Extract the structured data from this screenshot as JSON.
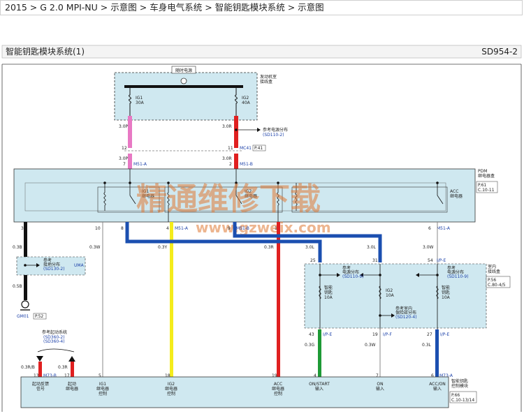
{
  "breadcrumb": {
    "items": [
      "2015",
      "G 2.0 MPI-NU",
      "示意图",
      "车身电气系统",
      "智能钥匙模块系统",
      "示意图"
    ],
    "separator": ">"
  },
  "diagram": {
    "title": "智能钥匙模块系统(1)",
    "code": "SD954-2",
    "watermark_cn": "精通维修下载",
    "watermark_url": "www.gzweix.com",
    "hot_label": "随时电源",
    "engine_box": "发动机室\n接线盒",
    "fuse_ig1": "IG1\n30A",
    "fuse_ig2": "IG2\n40A",
    "ref_power": "参考电源分布",
    "ref_power_code": "(SD110-2)",
    "wire_30p": "3.0P",
    "wire_30r": "3.0R",
    "pin_12": "12",
    "pin_11": "11",
    "conn_mc41": "MC41",
    "badge_p41": "P.41",
    "pin_7": "7",
    "pin_2": "2",
    "conn_m51a_top": "M51-A",
    "conn_m51b_top": "M51-B",
    "pdm_label": "PDM\n继电器盒",
    "pdm_page": "P.61\nC.10-11",
    "relay_ig1": "IG1\n继电器",
    "relay_ig2": "IG2\n继电器",
    "relay_acc": "ACC\n继电器",
    "pins_bottom": [
      "3",
      "10",
      "8",
      "4",
      "M51-A",
      "9",
      "M51-B",
      "1",
      "6",
      "M51-A"
    ],
    "wire_labels": [
      "0.3B",
      "0.3W",
      "0.3Y",
      "0.3R",
      "3.0L",
      "3.0L",
      "3.0W"
    ],
    "uma_ref": "参考\n接地分布\n(SD130-2)",
    "uma": "UMA",
    "wire_05b": "0.5B",
    "gm01": "GM01",
    "badge_p52": "P.52",
    "start_ref": "参考起动系统",
    "start_ref_codes": "(SD360-2)\n(SD360-4)",
    "indoor_pins": [
      "25",
      "31",
      "54",
      "I/P-E"
    ],
    "indoor_box": "室内\n接线盒",
    "indoor_page": "P.56\nC.80-4/5",
    "ref_power2": "参考\n电源分布\n(SD110-9)",
    "ref_power3": "参考\n电源分布\n(SD110-9)",
    "fuse_left": "智能\n钥匙\n10A",
    "fuse_mid": "IG2\n10A",
    "fuse_right": "智能\n钥匙\n10A",
    "ref_indoor": "参考室内\n保险丝分布\n(SD120-4)",
    "pins_lower": [
      "43",
      "I/P-E",
      "19",
      "I/P-F",
      "27",
      "I/P-E"
    ],
    "wire_03g": "0.3G",
    "wire_03w2": "0.3W",
    "wire_03l": "0.3L",
    "wire_03rb": "0.3R/B",
    "wire_03r2": "0.3R",
    "module_pins": [
      "13",
      "M73-B",
      "17",
      "5",
      "18",
      "19",
      "4",
      "7",
      "6",
      "M73-A"
    ],
    "module_labels": [
      "起动反馈\n信号",
      "起动\n继电器",
      "IG1\n继电器\n控制",
      "IG2\n继电器\n控制",
      "ACC\n继电器\n控制",
      "ON/START\n输入",
      "ON\n输入",
      "ACC/ON\n输入"
    ],
    "module_name": "智能钥匙\n控制模块",
    "module_page": "P.66\nC.10-13/14"
  },
  "colors": {
    "panel_fill": "#cfe8f0",
    "pink": "#e879c4",
    "red": "#e02020",
    "blue": "#1b4fb0",
    "yellow": "#f4ec1c",
    "green": "#1e9a36",
    "black": "#111111",
    "ref_blue": "#1a3fa8"
  }
}
